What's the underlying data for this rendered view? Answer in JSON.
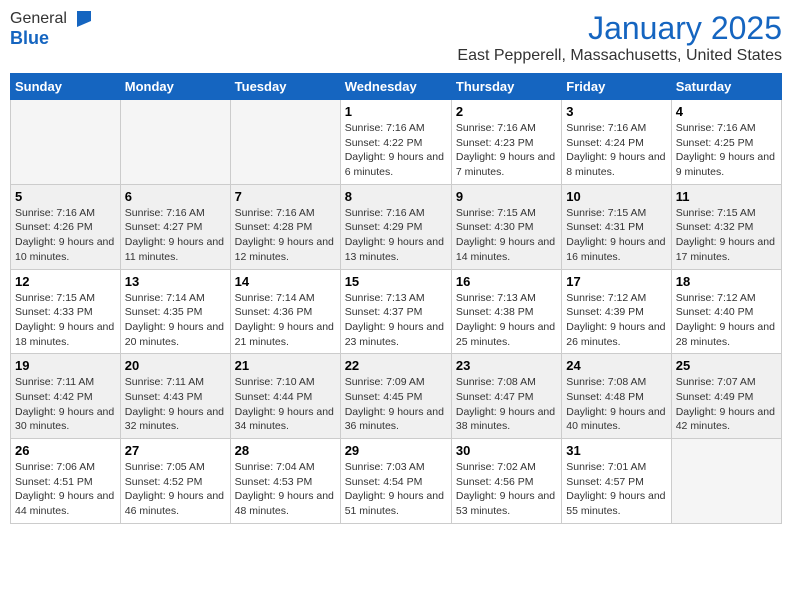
{
  "logo": {
    "general": "General",
    "blue": "Blue"
  },
  "title": {
    "month": "January 2025",
    "location": "East Pepperell, Massachusetts, United States"
  },
  "days_of_week": [
    "Sunday",
    "Monday",
    "Tuesday",
    "Wednesday",
    "Thursday",
    "Friday",
    "Saturday"
  ],
  "weeks": [
    {
      "shaded": false,
      "days": [
        {
          "num": "",
          "info": ""
        },
        {
          "num": "",
          "info": ""
        },
        {
          "num": "",
          "info": ""
        },
        {
          "num": "1",
          "info": "Sunrise: 7:16 AM\nSunset: 4:22 PM\nDaylight: 9 hours and 6 minutes."
        },
        {
          "num": "2",
          "info": "Sunrise: 7:16 AM\nSunset: 4:23 PM\nDaylight: 9 hours and 7 minutes."
        },
        {
          "num": "3",
          "info": "Sunrise: 7:16 AM\nSunset: 4:24 PM\nDaylight: 9 hours and 8 minutes."
        },
        {
          "num": "4",
          "info": "Sunrise: 7:16 AM\nSunset: 4:25 PM\nDaylight: 9 hours and 9 minutes."
        }
      ]
    },
    {
      "shaded": true,
      "days": [
        {
          "num": "5",
          "info": "Sunrise: 7:16 AM\nSunset: 4:26 PM\nDaylight: 9 hours and 10 minutes."
        },
        {
          "num": "6",
          "info": "Sunrise: 7:16 AM\nSunset: 4:27 PM\nDaylight: 9 hours and 11 minutes."
        },
        {
          "num": "7",
          "info": "Sunrise: 7:16 AM\nSunset: 4:28 PM\nDaylight: 9 hours and 12 minutes."
        },
        {
          "num": "8",
          "info": "Sunrise: 7:16 AM\nSunset: 4:29 PM\nDaylight: 9 hours and 13 minutes."
        },
        {
          "num": "9",
          "info": "Sunrise: 7:15 AM\nSunset: 4:30 PM\nDaylight: 9 hours and 14 minutes."
        },
        {
          "num": "10",
          "info": "Sunrise: 7:15 AM\nSunset: 4:31 PM\nDaylight: 9 hours and 16 minutes."
        },
        {
          "num": "11",
          "info": "Sunrise: 7:15 AM\nSunset: 4:32 PM\nDaylight: 9 hours and 17 minutes."
        }
      ]
    },
    {
      "shaded": false,
      "days": [
        {
          "num": "12",
          "info": "Sunrise: 7:15 AM\nSunset: 4:33 PM\nDaylight: 9 hours and 18 minutes."
        },
        {
          "num": "13",
          "info": "Sunrise: 7:14 AM\nSunset: 4:35 PM\nDaylight: 9 hours and 20 minutes."
        },
        {
          "num": "14",
          "info": "Sunrise: 7:14 AM\nSunset: 4:36 PM\nDaylight: 9 hours and 21 minutes."
        },
        {
          "num": "15",
          "info": "Sunrise: 7:13 AM\nSunset: 4:37 PM\nDaylight: 9 hours and 23 minutes."
        },
        {
          "num": "16",
          "info": "Sunrise: 7:13 AM\nSunset: 4:38 PM\nDaylight: 9 hours and 25 minutes."
        },
        {
          "num": "17",
          "info": "Sunrise: 7:12 AM\nSunset: 4:39 PM\nDaylight: 9 hours and 26 minutes."
        },
        {
          "num": "18",
          "info": "Sunrise: 7:12 AM\nSunset: 4:40 PM\nDaylight: 9 hours and 28 minutes."
        }
      ]
    },
    {
      "shaded": true,
      "days": [
        {
          "num": "19",
          "info": "Sunrise: 7:11 AM\nSunset: 4:42 PM\nDaylight: 9 hours and 30 minutes."
        },
        {
          "num": "20",
          "info": "Sunrise: 7:11 AM\nSunset: 4:43 PM\nDaylight: 9 hours and 32 minutes."
        },
        {
          "num": "21",
          "info": "Sunrise: 7:10 AM\nSunset: 4:44 PM\nDaylight: 9 hours and 34 minutes."
        },
        {
          "num": "22",
          "info": "Sunrise: 7:09 AM\nSunset: 4:45 PM\nDaylight: 9 hours and 36 minutes."
        },
        {
          "num": "23",
          "info": "Sunrise: 7:08 AM\nSunset: 4:47 PM\nDaylight: 9 hours and 38 minutes."
        },
        {
          "num": "24",
          "info": "Sunrise: 7:08 AM\nSunset: 4:48 PM\nDaylight: 9 hours and 40 minutes."
        },
        {
          "num": "25",
          "info": "Sunrise: 7:07 AM\nSunset: 4:49 PM\nDaylight: 9 hours and 42 minutes."
        }
      ]
    },
    {
      "shaded": false,
      "days": [
        {
          "num": "26",
          "info": "Sunrise: 7:06 AM\nSunset: 4:51 PM\nDaylight: 9 hours and 44 minutes."
        },
        {
          "num": "27",
          "info": "Sunrise: 7:05 AM\nSunset: 4:52 PM\nDaylight: 9 hours and 46 minutes."
        },
        {
          "num": "28",
          "info": "Sunrise: 7:04 AM\nSunset: 4:53 PM\nDaylight: 9 hours and 48 minutes."
        },
        {
          "num": "29",
          "info": "Sunrise: 7:03 AM\nSunset: 4:54 PM\nDaylight: 9 hours and 51 minutes."
        },
        {
          "num": "30",
          "info": "Sunrise: 7:02 AM\nSunset: 4:56 PM\nDaylight: 9 hours and 53 minutes."
        },
        {
          "num": "31",
          "info": "Sunrise: 7:01 AM\nSunset: 4:57 PM\nDaylight: 9 hours and 55 minutes."
        },
        {
          "num": "",
          "info": ""
        }
      ]
    }
  ]
}
